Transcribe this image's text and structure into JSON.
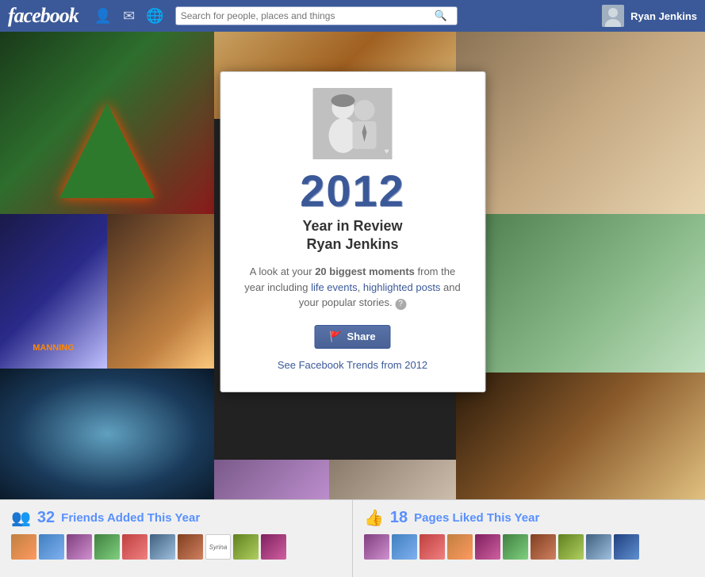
{
  "header": {
    "logo": "facebook",
    "search_placeholder": "Search for people, places and things",
    "username": "Ryan Jenkins"
  },
  "modal": {
    "year": "2012",
    "title_line1": "Year in Review",
    "title_line2": "Ryan Jenkins",
    "description_pre": "A look at your ",
    "description_bold": "20 biggest moments",
    "description_mid": " from the year including ",
    "description_link1": "life events",
    "description_comma": ", ",
    "description_link2": "highlighted posts",
    "description_post": " and your popular stories.",
    "share_button": "Share",
    "trends_link": "See Facebook Trends from 2012"
  },
  "bottom": {
    "friends_icon": "👥",
    "friends_count": "32",
    "friends_title": "Friends Added This Year",
    "likes_icon": "👍",
    "likes_count": "18",
    "likes_title": "Pages Liked This Year"
  }
}
